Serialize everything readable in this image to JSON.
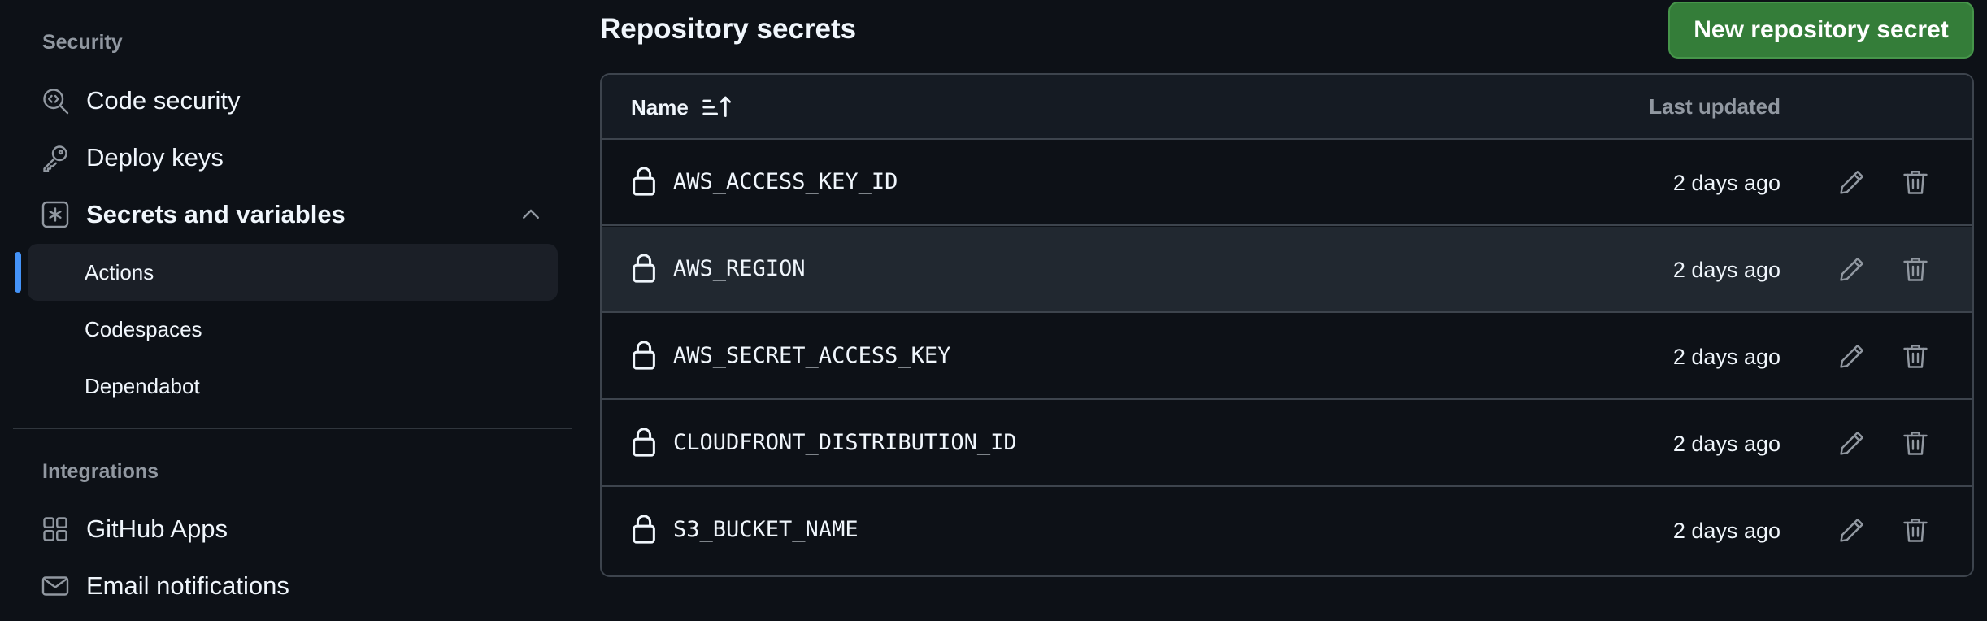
{
  "sidebar": {
    "security_heading": "Security",
    "security_items": [
      {
        "label": "Code security",
        "icon": "codescan-icon"
      },
      {
        "label": "Deploy keys",
        "icon": "key-icon"
      },
      {
        "label": "Secrets and variables",
        "icon": "asterisk-icon",
        "expanded": true
      }
    ],
    "sub_items": [
      {
        "label": "Actions",
        "active": true
      },
      {
        "label": "Codespaces",
        "active": false
      },
      {
        "label": "Dependabot",
        "active": false
      }
    ],
    "integrations_heading": "Integrations",
    "integration_items": [
      {
        "label": "GitHub Apps",
        "icon": "apps-icon"
      },
      {
        "label": "Email notifications",
        "icon": "mail-icon"
      }
    ]
  },
  "main": {
    "title": "Repository secrets",
    "new_button": "New repository secret",
    "table": {
      "col_name": "Name",
      "col_updated": "Last updated",
      "rows": [
        {
          "name": "AWS_ACCESS_KEY_ID",
          "updated": "2 days ago"
        },
        {
          "name": "AWS_REGION",
          "updated": "2 days ago"
        },
        {
          "name": "AWS_SECRET_ACCESS_KEY",
          "updated": "2 days ago"
        },
        {
          "name": "CLOUDFRONT_DISTRIBUTION_ID",
          "updated": "2 days ago"
        },
        {
          "name": "S3_BUCKET_NAME",
          "updated": "2 days ago"
        }
      ]
    }
  },
  "colors": {
    "background": "#0d1117",
    "primary_button": "#347d39",
    "active_indicator": "#4493f8",
    "border": "#3d444d"
  }
}
